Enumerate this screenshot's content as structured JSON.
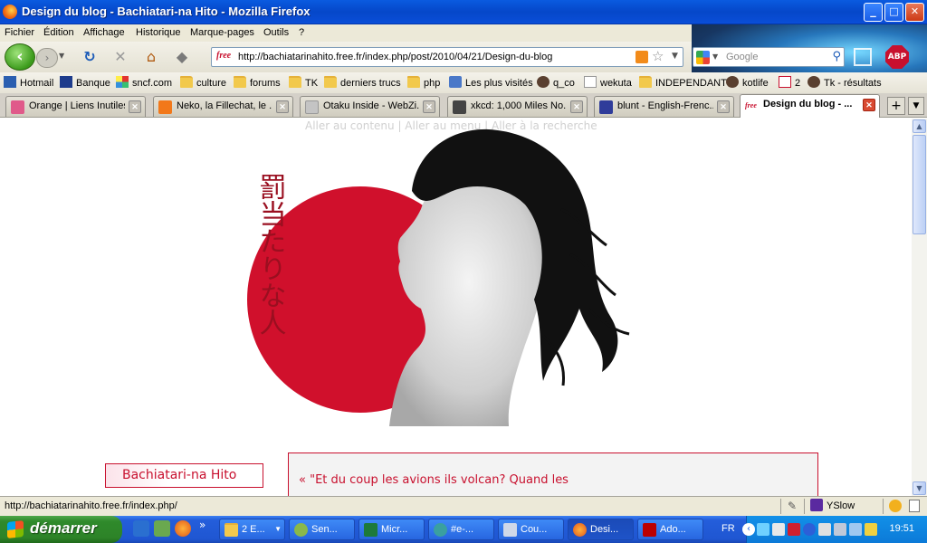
{
  "window": {
    "title": "Design du blog - Bachiatari-na Hito - Mozilla Firefox",
    "minimize": "_",
    "maximize": "□",
    "close": "✕"
  },
  "menu": [
    "Fichier",
    "Édition",
    "Affichage",
    "Historique",
    "Marque-pages",
    "Outils",
    "?"
  ],
  "nav": {
    "url": "http://bachiatarinahito.free.fr/index.php/post/2010/04/21/Design-du-blog",
    "site_badge": "free",
    "search_placeholder": "Google",
    "abp_label": "ABP"
  },
  "bookmarks": [
    {
      "label": "Hotmail",
      "icon": "hotmail-icon"
    },
    {
      "label": "Banque",
      "icon": "bank-icon"
    },
    {
      "label": "sncf.com",
      "icon": "sncf-icon"
    },
    {
      "label": "culture",
      "icon": "folder-icon"
    },
    {
      "label": "forums",
      "icon": "folder-icon"
    },
    {
      "label": "TK",
      "icon": "folder-icon"
    },
    {
      "label": "derniers trucs",
      "icon": "folder-icon"
    },
    {
      "label": "php",
      "icon": "folder-icon"
    },
    {
      "label": "Les plus visités",
      "icon": "most-visited-icon"
    },
    {
      "label": "q_co",
      "icon": "avatar-icon"
    },
    {
      "label": "wekuta",
      "icon": "page-icon"
    },
    {
      "label": "INDEPENDANT",
      "icon": "folder-icon"
    },
    {
      "label": "kotlife",
      "icon": "avatar-icon"
    },
    {
      "label": "2",
      "icon": "adobe-icon"
    },
    {
      "label": "Tk - résultats",
      "icon": "avatar-icon"
    }
  ],
  "tabs": [
    {
      "label": "Orange | Liens Inutiles",
      "active": false
    },
    {
      "label": "Neko, la Fillechat, le ...",
      "active": false
    },
    {
      "label": "Otaku Inside - WebZi...",
      "active": false
    },
    {
      "label": "xkcd: 1,000 Miles No...",
      "active": false
    },
    {
      "label": "blunt - English-Frenc...",
      "active": false
    },
    {
      "label": "Design du blog - ...",
      "active": true
    }
  ],
  "page": {
    "skip_links": "Aller au contenu | Aller au menu | Aller à la recherche",
    "sidebar_title": "Bachiatari-na Hito",
    "post_excerpt": "« \"Et du coup les avions ils volcan? Quand les",
    "banner_kanji": "罰当たりな人"
  },
  "status": {
    "text": "http://bachiatarinahito.free.fr/index.php/",
    "yslow": "YSlow"
  },
  "taskbar": {
    "start": "démarrer",
    "chevron": "»",
    "items": [
      {
        "label": "2 E...",
        "icon": "folder-icon"
      },
      {
        "label": "Sen...",
        "icon": "messenger-icon"
      },
      {
        "label": "Micr...",
        "icon": "excel-icon"
      },
      {
        "label": "#e-...",
        "icon": "chat-icon"
      },
      {
        "label": "Cou...",
        "icon": "mail-icon"
      },
      {
        "label": "Desi...",
        "icon": "firefox-icon"
      },
      {
        "label": "Ado...",
        "icon": "adobe-icon"
      }
    ],
    "language": "FR",
    "clock": "19:51"
  },
  "colors": {
    "accent_red": "#c8102e",
    "xp_blue": "#245edb",
    "start_green": "#2f8a2b"
  }
}
